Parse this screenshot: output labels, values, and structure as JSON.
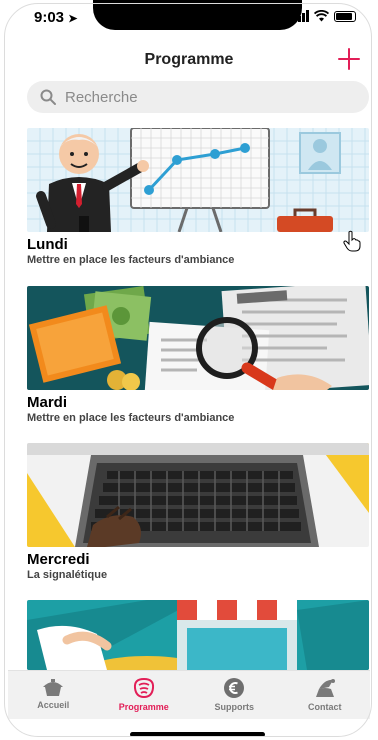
{
  "status": {
    "time": "9:03"
  },
  "header": {
    "title": "Programme",
    "add_icon": "plus-icon"
  },
  "search": {
    "placeholder": "Recherche"
  },
  "colors": {
    "accent": "#e21e57",
    "tab_inactive": "#7a7a7a"
  },
  "cards": [
    {
      "title": "Lundi",
      "subtitle": "Mettre en place les facteurs d'ambiance"
    },
    {
      "title": "Mardi",
      "subtitle": "Mettre en place les facteurs d'ambiance"
    },
    {
      "title": "Mercredi",
      "subtitle": "La signalétique"
    },
    {
      "title": "",
      "subtitle": ""
    }
  ],
  "tabs": [
    {
      "label": "Accueil",
      "icon": "home-icon",
      "active": false
    },
    {
      "label": "Programme",
      "icon": "programme-icon",
      "active": true
    },
    {
      "label": "Supports",
      "icon": "euro-icon",
      "active": false
    },
    {
      "label": "Contact",
      "icon": "contact-icon",
      "active": false
    }
  ]
}
